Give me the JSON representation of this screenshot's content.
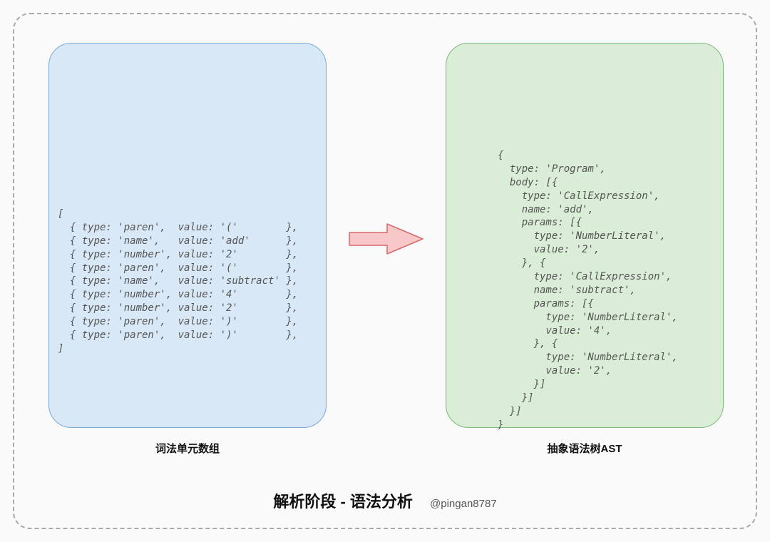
{
  "left_caption": "词法单元数组",
  "right_caption": "抽象语法树AST",
  "title": "解析阶段 - 语法分析",
  "author": "@pingan8787",
  "left_code": "[\n  { type: 'paren',  value: '('        },\n  { type: 'name',   value: 'add'      },\n  { type: 'number', value: '2'        },\n  { type: 'paren',  value: '('        },\n  { type: 'name',   value: 'subtract' },\n  { type: 'number', value: '4'        },\n  { type: 'number', value: '2'        },\n  { type: 'paren',  value: ')'        },\n  { type: 'paren',  value: ')'        },\n]",
  "right_code": "{\n  type: 'Program',\n  body: [{\n    type: 'CallExpression',\n    name: 'add',\n    params: [{\n      type: 'NumberLiteral',\n      value: '2',\n    }, {\n      type: 'CallExpression',\n      name: 'subtract',\n      params: [{\n        type: 'NumberLiteral',\n        value: '4',\n      }, {\n        type: 'NumberLiteral',\n        value: '2',\n      }]\n    }]\n  }]\n}"
}
